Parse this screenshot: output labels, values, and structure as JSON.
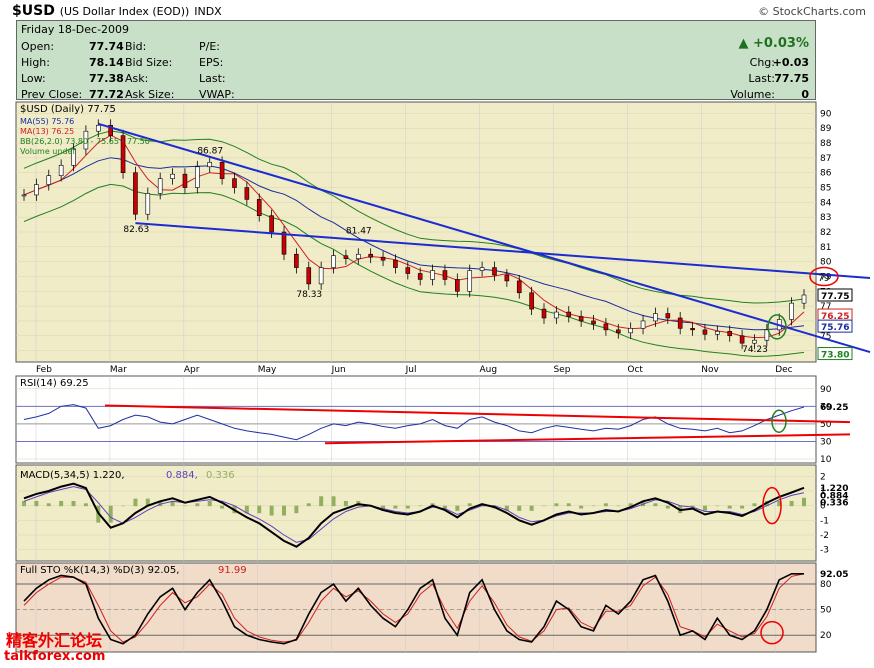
{
  "header": {
    "symbol": "$USD",
    "name": "(US Dollar Index (EOD))",
    "exchange": "INDX",
    "brand": "© StockCharts.com"
  },
  "info": {
    "date": "Friday   18-Dec-2009",
    "left": [
      [
        "Open:",
        "77.74"
      ],
      [
        "High:",
        "78.14"
      ],
      [
        "Low:",
        "77.38"
      ],
      [
        "Prev Close:",
        "77.72"
      ]
    ],
    "mid": [
      [
        "Bid:",
        ""
      ],
      [
        "Bid Size:",
        ""
      ],
      [
        "Ask:",
        ""
      ],
      [
        "Ask Size:",
        ""
      ]
    ],
    "right": [
      [
        "P/E:",
        ""
      ],
      [
        "EPS:",
        ""
      ],
      [
        "Last:",
        ""
      ],
      [
        "VWAP:",
        ""
      ]
    ],
    "change_pct": "▲ +0.03%",
    "stats": [
      [
        "Chg:",
        "+0.03"
      ],
      [
        "Last:",
        "77.75"
      ],
      [
        "Volume:",
        "0"
      ]
    ]
  },
  "chart_data": [
    {
      "type": "line",
      "title": "$USD (Daily) 77.75",
      "legend": [
        "MA(55) 75.76",
        "MA(13) 76.25",
        "BB(26,2.0) 73.80 - 75.65 - 77.50",
        "Volume undef"
      ],
      "legend_colors": [
        "#1c2c9c",
        "#d02020",
        "#208020",
        "#208020"
      ],
      "x": [
        "Feb",
        "Mar",
        "Apr",
        "May",
        "Jun",
        "Jul",
        "Aug",
        "Sep",
        "Oct",
        "Nov",
        "Dec"
      ],
      "ylim": [
        73.5,
        90.5
      ],
      "y_ticks": [
        "90",
        "89",
        "88",
        "87",
        "86",
        "85",
        "84",
        "83",
        "82",
        "81",
        "80",
        "79",
        "78",
        "77",
        "76",
        "75",
        "74"
      ],
      "price": [
        84.5,
        85.2,
        85.8,
        86.5,
        87.6,
        88.8,
        89.2,
        88.5,
        86.0,
        83.2,
        84.6,
        85.6,
        85.9,
        85.0,
        86.4,
        86.7,
        85.6,
        85.0,
        84.2,
        83.1,
        82.0,
        80.5,
        79.6,
        78.5,
        79.6,
        80.4,
        80.2,
        80.5,
        80.3,
        80.1,
        79.6,
        79.2,
        78.8,
        79.4,
        78.8,
        78.0,
        79.4,
        79.6,
        79.1,
        78.7,
        77.9,
        76.8,
        76.2,
        76.6,
        76.3,
        76.0,
        75.8,
        75.4,
        75.2,
        75.5,
        76.0,
        76.5,
        76.2,
        75.5,
        75.4,
        75.1,
        75.3,
        75.0,
        74.5,
        74.7,
        75.4,
        76.1,
        77.2,
        77.75
      ],
      "annotations": [
        "86.87",
        "82.63",
        "81.47",
        "78.33",
        "74.23",
        "79"
      ],
      "price_labels": [
        {
          "text": "77.75",
          "y": 77.75,
          "color": "#000"
        },
        {
          "text": "76.25",
          "y": 76.4,
          "color": "#d02020"
        },
        {
          "text": "75.76",
          "y": 75.65,
          "color": "#1c2c9c"
        },
        {
          "text": "73.80",
          "y": 73.8,
          "color": "#208020"
        }
      ]
    },
    {
      "type": "line",
      "title": "RSI(14) 69.25",
      "ylim": [
        10,
        100
      ],
      "y_ticks": [
        "90",
        "70",
        "50",
        "30",
        "10"
      ],
      "values": [
        55,
        58,
        62,
        70,
        72,
        68,
        45,
        48,
        55,
        60,
        58,
        52,
        50,
        55,
        60,
        55,
        50,
        45,
        42,
        40,
        38,
        35,
        32,
        38,
        45,
        50,
        48,
        52,
        50,
        47,
        45,
        48,
        50,
        55,
        48,
        45,
        55,
        58,
        52,
        48,
        42,
        40,
        45,
        48,
        46,
        44,
        42,
        45,
        44,
        48,
        55,
        58,
        50,
        45,
        44,
        42,
        45,
        40,
        42,
        48,
        55,
        60,
        65,
        69.25
      ],
      "current": "69.25"
    },
    {
      "type": "line",
      "title": "MACD(5,34,5) 1.220, 0.884, 0.336",
      "title_parts": [
        "MACD(5,34,5)",
        "1.220,",
        "0.884,",
        "0.336"
      ],
      "ylim": [
        -3.5,
        2.5
      ],
      "y_ticks": [
        "2",
        "1",
        "0",
        "-1",
        "-2",
        "-3"
      ],
      "macd": [
        0.5,
        0.8,
        1.0,
        1.3,
        1.5,
        1.2,
        -0.5,
        -1.5,
        -1.2,
        -0.5,
        0,
        0.3,
        0.5,
        0.2,
        0.4,
        0.6,
        0.2,
        -0.3,
        -0.8,
        -1.2,
        -1.8,
        -2.4,
        -2.8,
        -2.2,
        -1.2,
        -0.5,
        -0.2,
        0.1,
        0,
        -0.3,
        -0.5,
        -0.6,
        -0.4,
        0,
        -0.3,
        -0.8,
        -0.2,
        0.1,
        -0.1,
        -0.5,
        -1.0,
        -1.3,
        -1.0,
        -0.6,
        -0.4,
        -0.6,
        -0.5,
        -0.3,
        -0.4,
        -0.1,
        0.3,
        0.5,
        0.2,
        -0.3,
        -0.2,
        -0.6,
        -0.4,
        -0.5,
        -0.7,
        -0.3,
        0.2,
        0.6,
        0.9,
        1.22
      ],
      "signal": [
        0.3,
        0.6,
        0.9,
        1.1,
        1.3,
        1.1,
        0.2,
        -0.8,
        -1.2,
        -0.8,
        -0.3,
        0.1,
        0.3,
        0.2,
        0.3,
        0.4,
        0.3,
        0,
        -0.5,
        -0.9,
        -1.4,
        -2.0,
        -2.5,
        -2.3,
        -1.6,
        -0.9,
        -0.4,
        -0.1,
        0,
        -0.2,
        -0.4,
        -0.5,
        -0.4,
        -0.1,
        -0.2,
        -0.6,
        -0.3,
        0,
        0,
        -0.3,
        -0.8,
        -1.1,
        -1.0,
        -0.7,
        -0.5,
        -0.5,
        -0.5,
        -0.4,
        -0.4,
        -0.2,
        0.1,
        0.4,
        0.3,
        0,
        -0.1,
        -0.4,
        -0.4,
        -0.4,
        -0.6,
        -0.4,
        0,
        0.4,
        0.7,
        0.884
      ],
      "current": [
        "1.220",
        "0.884",
        "0.336"
      ]
    },
    {
      "type": "line",
      "title": "Full STO %K(14,3) %D(3) 92.05, 91.99",
      "title_parts": [
        "Full STO %K(14,3) %D(3)",
        "92.05,",
        "91.99"
      ],
      "ylim": [
        5,
        100
      ],
      "y_ticks": [
        "80",
        "50",
        "20"
      ],
      "k": [
        60,
        75,
        85,
        90,
        88,
        80,
        40,
        15,
        10,
        20,
        45,
        65,
        75,
        50,
        70,
        85,
        60,
        30,
        20,
        15,
        12,
        10,
        15,
        45,
        70,
        80,
        60,
        75,
        55,
        40,
        30,
        50,
        75,
        85,
        40,
        20,
        70,
        85,
        50,
        25,
        15,
        12,
        30,
        60,
        50,
        30,
        25,
        55,
        45,
        60,
        85,
        90,
        60,
        20,
        25,
        15,
        40,
        20,
        15,
        25,
        50,
        85,
        92,
        92.05
      ],
      "d": [
        55,
        70,
        80,
        88,
        88,
        82,
        55,
        25,
        12,
        18,
        35,
        55,
        70,
        58,
        65,
        80,
        68,
        40,
        25,
        18,
        14,
        12,
        14,
        35,
        60,
        75,
        65,
        72,
        60,
        45,
        35,
        45,
        68,
        80,
        50,
        28,
        60,
        78,
        58,
        32,
        18,
        13,
        25,
        50,
        52,
        35,
        28,
        48,
        48,
        55,
        78,
        88,
        68,
        30,
        25,
        18,
        33,
        25,
        18,
        22,
        42,
        75,
        89,
        91.99
      ],
      "current": [
        "92.05",
        "91.99"
      ]
    }
  ]
}
